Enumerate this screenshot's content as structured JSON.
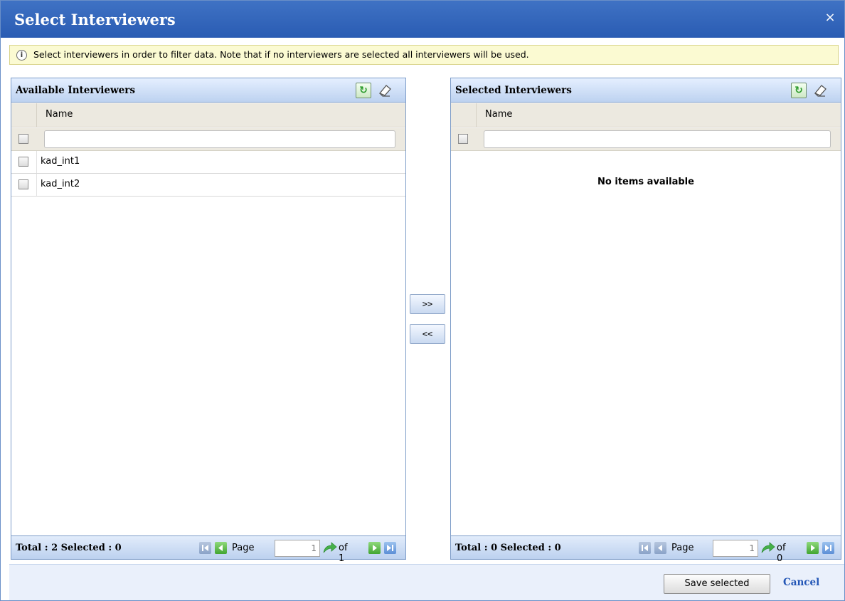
{
  "dialog": {
    "title": "Select Interviewers",
    "close_icon": "close-icon",
    "close_glyph": "×",
    "notice": "Select interviewers in order to filter data. Note that if no interviewers are selected all interviewers will be used."
  },
  "available": {
    "title": "Available Interviewers",
    "column_name": "Name",
    "filter_value": "",
    "rows": [
      {
        "name": "kad_int1",
        "checked": false
      },
      {
        "name": "kad_int2",
        "checked": false
      }
    ],
    "footer": {
      "total_text": "Total : 2 Selected : 0",
      "page_label": "Page",
      "page_value": "1",
      "of_text": "of 1"
    }
  },
  "selected": {
    "title": "Selected Interviewers",
    "column_name": "Name",
    "filter_value": "",
    "empty_text": "No items available",
    "footer": {
      "total_text": "Total : 0 Selected : 0",
      "page_label": "Page",
      "page_value": "1",
      "of_text": "of 0"
    }
  },
  "move": {
    "add_label": ">>",
    "remove_label": "<<"
  },
  "actions": {
    "save_label": "Save selected",
    "cancel_label": "Cancel"
  },
  "colors": {
    "titlebar": "#2f63b8",
    "link": "#2356b6",
    "notice_bg": "#fbfad2"
  }
}
